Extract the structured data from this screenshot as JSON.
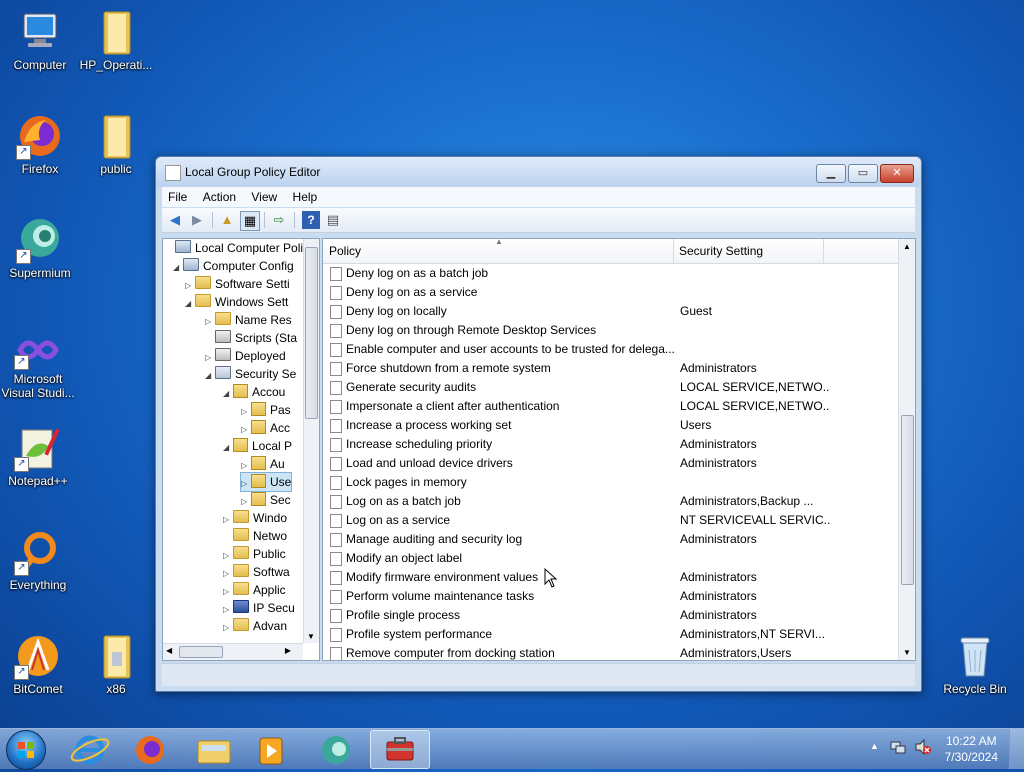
{
  "desktop": {
    "icons": [
      {
        "label": "Computer"
      },
      {
        "label": "HP_Operati..."
      },
      {
        "label": "Firefox"
      },
      {
        "label": "public"
      },
      {
        "label": "Supermium"
      },
      {
        "label": "Microsoft Visual Studi..."
      },
      {
        "label": "Notepad++"
      },
      {
        "label": "Everything"
      },
      {
        "label": "BitComet"
      },
      {
        "label": "x86"
      },
      {
        "label": "Recycle Bin"
      }
    ]
  },
  "window": {
    "title": "Local Group Policy Editor",
    "menu": [
      "File",
      "Action",
      "View",
      "Help"
    ],
    "tree": [
      {
        "label": "Local Computer Polic",
        "level": 0,
        "expander": "",
        "icon": "computer"
      },
      {
        "label": "Computer Config",
        "level": 1,
        "expander": "◢",
        "icon": "computer"
      },
      {
        "label": "Software Setti",
        "level": 2,
        "expander": "▷",
        "icon": "folder"
      },
      {
        "label": "Windows Sett",
        "level": 2,
        "expander": "◢",
        "icon": "folder"
      },
      {
        "label": "Name Res",
        "level": 3,
        "expander": "▷",
        "icon": "folder"
      },
      {
        "label": "Scripts (Sta",
        "level": 3,
        "expander": "",
        "icon": "script"
      },
      {
        "label": "Deployed",
        "level": 3,
        "expander": "▷",
        "icon": "printer"
      },
      {
        "label": "Security Se",
        "level": 3,
        "expander": "◢",
        "icon": "security"
      },
      {
        "label": "Accou",
        "level": 4,
        "expander": "◢",
        "icon": "lockfolder"
      },
      {
        "label": "Pas",
        "level": 5,
        "expander": "▷",
        "icon": "lockfolder"
      },
      {
        "label": "Acc",
        "level": 5,
        "expander": "▷",
        "icon": "lockfolder"
      },
      {
        "label": "Local P",
        "level": 4,
        "expander": "◢",
        "icon": "lockfolder"
      },
      {
        "label": "Au",
        "level": 5,
        "expander": "▷",
        "icon": "lockfolder"
      },
      {
        "label": "Use",
        "level": 5,
        "expander": "▷",
        "icon": "lockfolder",
        "selected": true
      },
      {
        "label": "Sec",
        "level": 5,
        "expander": "▷",
        "icon": "lockfolder"
      },
      {
        "label": "Windo",
        "level": 4,
        "expander": "▷",
        "icon": "folder"
      },
      {
        "label": "Netwo",
        "level": 4,
        "expander": "",
        "icon": "folder"
      },
      {
        "label": "Public",
        "level": 4,
        "expander": "▷",
        "icon": "folder"
      },
      {
        "label": "Softwa",
        "level": 4,
        "expander": "▷",
        "icon": "folder"
      },
      {
        "label": "Applic",
        "level": 4,
        "expander": "▷",
        "icon": "folder"
      },
      {
        "label": "IP Secu",
        "level": 4,
        "expander": "▷",
        "icon": "shield"
      },
      {
        "label": "Advan",
        "level": 4,
        "expander": "▷",
        "icon": "folder"
      }
    ],
    "columns": {
      "policy": "Policy",
      "setting": "Security Setting"
    },
    "rows": [
      {
        "policy": "Deny log on as a batch job",
        "setting": ""
      },
      {
        "policy": "Deny log on as a service",
        "setting": ""
      },
      {
        "policy": "Deny log on locally",
        "setting": "Guest"
      },
      {
        "policy": "Deny log on through Remote Desktop Services",
        "setting": ""
      },
      {
        "policy": "Enable computer and user accounts to be trusted for delega...",
        "setting": ""
      },
      {
        "policy": "Force shutdown from a remote system",
        "setting": "Administrators"
      },
      {
        "policy": "Generate security audits",
        "setting": "LOCAL SERVICE,NETWO..."
      },
      {
        "policy": "Impersonate a client after authentication",
        "setting": "LOCAL SERVICE,NETWO..."
      },
      {
        "policy": "Increase a process working set",
        "setting": "Users"
      },
      {
        "policy": "Increase scheduling priority",
        "setting": "Administrators"
      },
      {
        "policy": "Load and unload device drivers",
        "setting": "Administrators"
      },
      {
        "policy": "Lock pages in memory",
        "setting": ""
      },
      {
        "policy": "Log on as a batch job",
        "setting": "Administrators,Backup ..."
      },
      {
        "policy": "Log on as a service",
        "setting": "NT SERVICE\\ALL SERVIC..."
      },
      {
        "policy": "Manage auditing and security log",
        "setting": "Administrators"
      },
      {
        "policy": "Modify an object label",
        "setting": ""
      },
      {
        "policy": "Modify firmware environment values",
        "setting": "Administrators"
      },
      {
        "policy": "Perform volume maintenance tasks",
        "setting": "Administrators"
      },
      {
        "policy": "Profile single process",
        "setting": "Administrators"
      },
      {
        "policy": "Profile system performance",
        "setting": "Administrators,NT SERVI..."
      },
      {
        "policy": "Remove computer from docking station",
        "setting": "Administrators,Users"
      }
    ]
  },
  "taskbar": {
    "time": "10:22 AM",
    "date": "7/30/2024"
  }
}
